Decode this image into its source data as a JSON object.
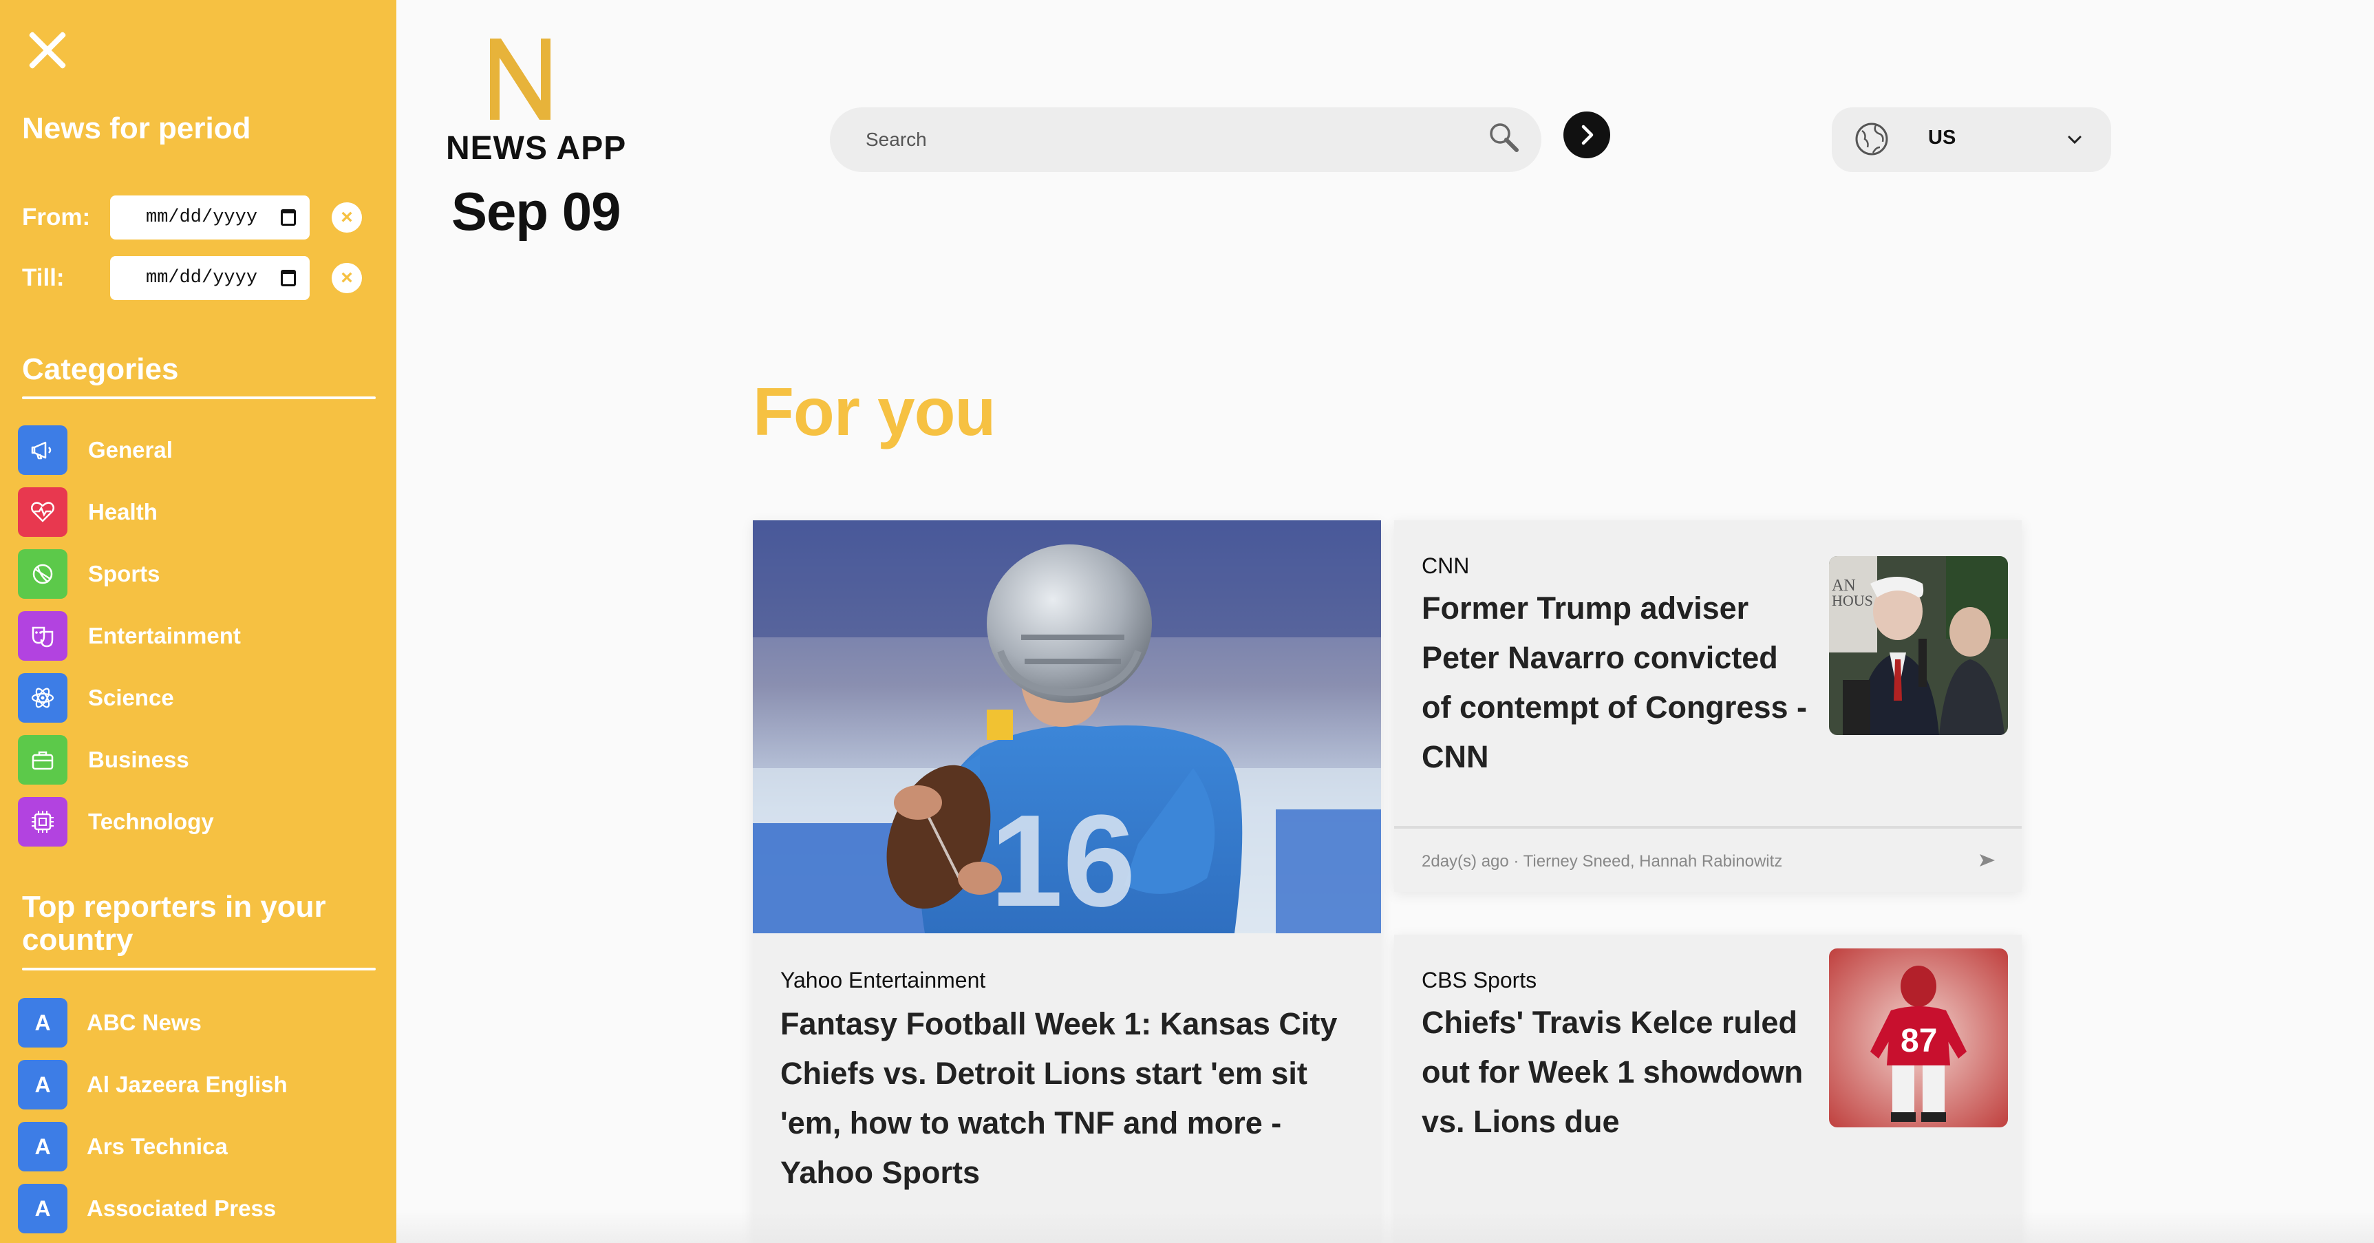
{
  "sidebar": {
    "period_heading": "News for period",
    "from_label": "From:",
    "till_label": "Till:",
    "from_value": "mm/dd/yyyy",
    "till_value": "mm/dd/yyyy",
    "categories_heading": "Categories",
    "categories": [
      {
        "label": "General",
        "icon": "megaphone-icon",
        "color": "#3d7de6"
      },
      {
        "label": "Health",
        "icon": "heartbeat-icon",
        "color": "#e8384f"
      },
      {
        "label": "Sports",
        "icon": "ball-icon",
        "color": "#5cc94a"
      },
      {
        "label": "Entertainment",
        "icon": "masks-icon",
        "color": "#b243e0"
      },
      {
        "label": "Science",
        "icon": "atom-icon",
        "color": "#3d7de6"
      },
      {
        "label": "Business",
        "icon": "briefcase-icon",
        "color": "#5cc94a"
      },
      {
        "label": "Technology",
        "icon": "chip-icon",
        "color": "#b243e0"
      }
    ],
    "reporters_heading": "Top reporters in your country",
    "reporters": [
      {
        "initial": "A",
        "label": "ABC News"
      },
      {
        "initial": "A",
        "label": "Al Jazeera English"
      },
      {
        "initial": "A",
        "label": "Ars Technica"
      },
      {
        "initial": "A",
        "label": "Associated Press"
      }
    ]
  },
  "header": {
    "logo_letter": "N",
    "logo_text": "NEWS APP",
    "date": "Sep 09",
    "search_placeholder": "Search",
    "country": "US"
  },
  "main": {
    "section_title": "For you",
    "articles": [
      {
        "source": "Yahoo Entertainment",
        "title": "Fantasy Football Week 1: Kansas City Chiefs vs. Detroit Lions start 'em sit 'em, how to watch TNF and more - Yahoo Sports"
      },
      {
        "source": "CNN",
        "title": "Former Trump adviser Peter Navarro convicted of contempt of Congress - CNN",
        "meta": "2day(s) ago · Tierney Sneed, Hannah Rabinowitz"
      },
      {
        "source": "CBS Sports",
        "title": "Chiefs' Travis Kelce ruled out for Week 1 showdown vs. Lions due"
      }
    ]
  },
  "colors": {
    "brand_yellow": "#f6c142",
    "blue": "#3d7de6",
    "red": "#e8384f",
    "green": "#5cc94a",
    "purple": "#b243e0"
  }
}
